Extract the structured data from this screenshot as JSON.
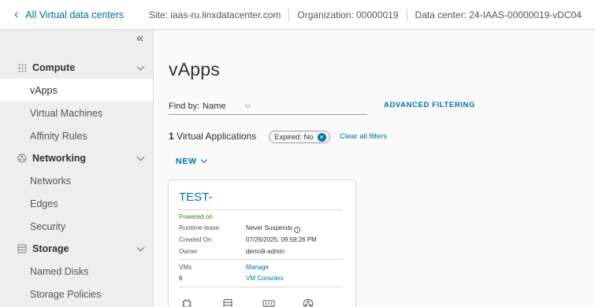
{
  "header": {
    "back_label": "All Virtual data centers",
    "site": "Site: iaas-ru.linxdatacenter.com",
    "organization": "Organization: 00000019",
    "datacenter": "Data center: 24-IAAS-00000019-vDC04"
  },
  "sidebar": {
    "collapse_glyph": "«",
    "groups": [
      {
        "label": "Compute",
        "icon": "grid-icon",
        "items": [
          "vApps",
          "Virtual Machines",
          "Affinity Rules"
        ]
      },
      {
        "label": "Networking",
        "icon": "network-icon",
        "items": [
          "Networks",
          "Edges",
          "Security"
        ]
      },
      {
        "label": "Storage",
        "icon": "storage-icon",
        "items": [
          "Named Disks",
          "Storage Policies"
        ]
      }
    ],
    "active_item": "vApps"
  },
  "main": {
    "title": "vApps",
    "find_by_label": "Find by:",
    "find_by_value": "Name",
    "advanced_filtering": "ADVANCED FILTERING",
    "count_number": "1",
    "count_label": "Virtual Applications",
    "filter_chip": "Expired: No",
    "clear_filters": "Clear all filters",
    "new_button": "NEW"
  },
  "card": {
    "title": "TEST-",
    "status": "Powered on",
    "runtime_lease_label": "Runtime lease",
    "runtime_lease_value": "Never Suspends",
    "created_label": "Created On",
    "created_value": "07/26/2025, 09:59:26 PM",
    "owner_label": "Owner",
    "owner_value": "demo9-admin",
    "vms_label": "VMs",
    "vms_value": "6",
    "manage_link": "Manage",
    "consoles_link": "VM Consoles",
    "icons": [
      "cpu-icon",
      "storage-icon",
      "memory-icon",
      "network-icon"
    ]
  },
  "colors": {
    "accent": "#0072a3",
    "status_ok": "#318700",
    "sidebar_bg": "#eeeeee"
  }
}
